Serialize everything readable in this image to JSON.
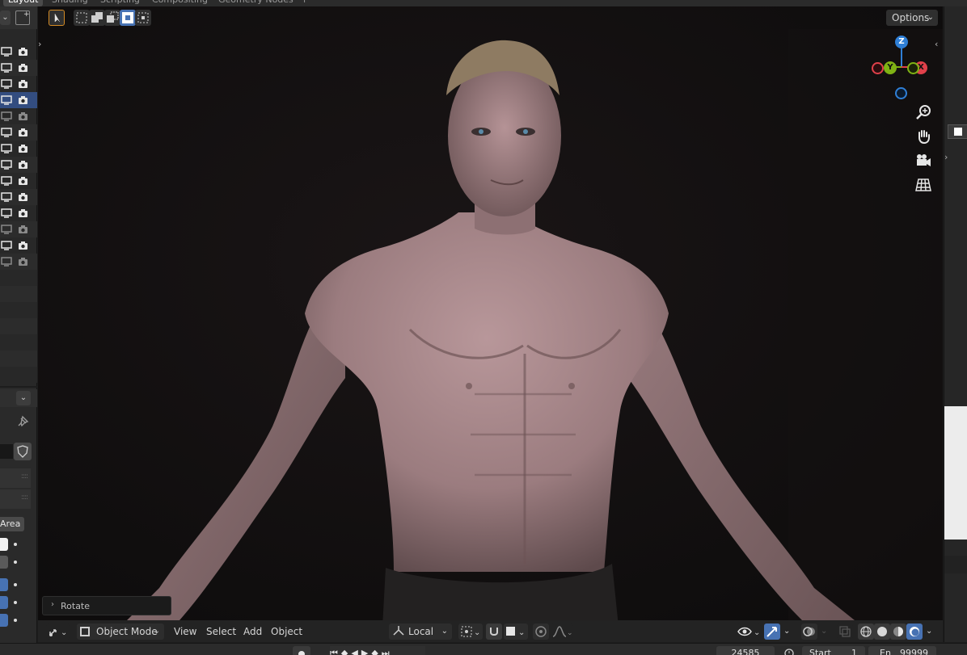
{
  "workspace_tabs": [
    {
      "label": "Layout",
      "active": true
    },
    {
      "label": "Shading",
      "active": false
    },
    {
      "label": "Scripting",
      "active": false
    },
    {
      "label": "Compositing",
      "active": false
    },
    {
      "label": "Geometry Nodes",
      "active": false
    },
    {
      "label": "+",
      "active": false
    }
  ],
  "viewport_header": {
    "options_label": "Options",
    "select_mode_icons": [
      "select-box-icon",
      "mode-new-icon",
      "mode-extend-icon",
      "mode-subtract-icon",
      "mode-invert-icon",
      "mode-intersect-icon"
    ]
  },
  "viewport_footer": {
    "mode_label": "Object Mode",
    "menus": [
      "View",
      "Select",
      "Add",
      "Object"
    ],
    "transform_orientation": "Local"
  },
  "operator_panel": {
    "label": "Rotate"
  },
  "left_panel": {
    "area_label": "Area"
  },
  "timeline": {
    "current_frame": "24585",
    "start_label": "Start",
    "start_value": "1",
    "end_label": "En",
    "end_value": "99999"
  },
  "gizmo": {
    "z_label": "Z",
    "y_label": "Y",
    "x_label": "X"
  },
  "colors": {
    "selection": "#334d80",
    "axis_x": "#e0404a",
    "axis_y": "#7fb214",
    "axis_z": "#2f7fd6",
    "active_button": "#4772b3"
  }
}
